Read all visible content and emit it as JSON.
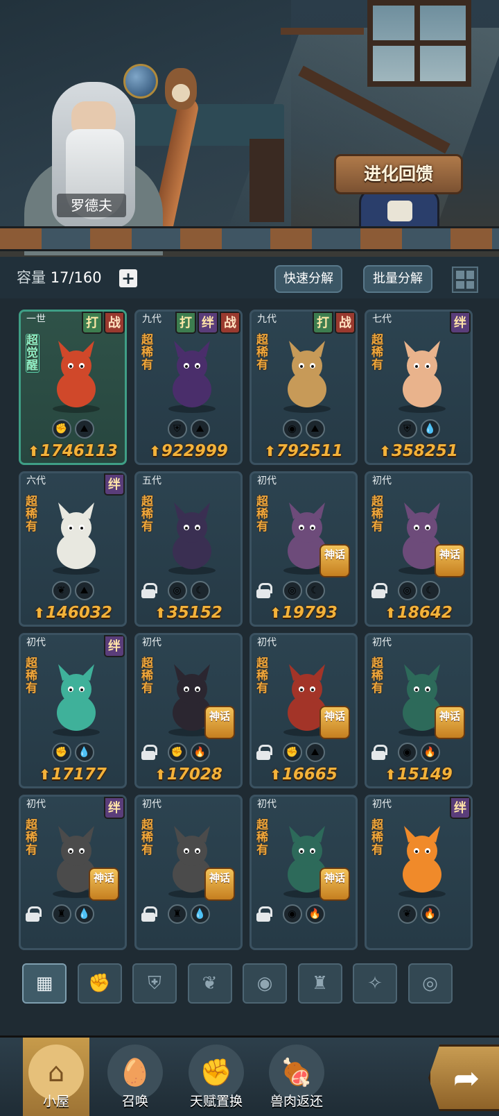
{
  "scene": {
    "npc_name": "罗德夫",
    "evolution_button": "进化回馈"
  },
  "capacity": {
    "label": "容量",
    "value": "17/160",
    "add_icon": "plus-icon"
  },
  "toolbar": {
    "quick_decompose": "快速分解",
    "batch_decompose": "批量分解",
    "view_toggle_icon": "grid-view-icon"
  },
  "cards": [
    {
      "gen": "一世",
      "rarity": "超觉醒",
      "tags": [
        "打",
        "战"
      ],
      "elements": [
        "fist-element",
        "earth-element"
      ],
      "power": "1746113",
      "locked": false,
      "mythic": false,
      "top_tier": true
    },
    {
      "gen": "九代",
      "rarity": "超稀有",
      "tags": [
        "打",
        "绊",
        "战"
      ],
      "elements": [
        "shield-element",
        "earth-element"
      ],
      "power": "922999",
      "locked": false,
      "mythic": false
    },
    {
      "gen": "九代",
      "rarity": "超稀有",
      "tags": [
        "打",
        "战"
      ],
      "elements": [
        "alien-element",
        "earth-element"
      ],
      "power": "792511",
      "locked": false,
      "mythic": false
    },
    {
      "gen": "七代",
      "rarity": "超稀有",
      "tags": [
        "绊"
      ],
      "elements": [
        "shield-element",
        "water-element"
      ],
      "power": "358251",
      "locked": false,
      "mythic": false
    },
    {
      "gen": "六代",
      "rarity": "超稀有",
      "tags": [
        "绊"
      ],
      "elements": [
        "sprout-element",
        "earth-element"
      ],
      "power": "146032",
      "locked": false,
      "mythic": false
    },
    {
      "gen": "五代",
      "rarity": "超稀有",
      "tags": [],
      "elements": [
        "eye-element",
        "moon-element"
      ],
      "power": "35152",
      "locked": true,
      "mythic": false
    },
    {
      "gen": "初代",
      "rarity": "超稀有",
      "tags": [],
      "elements": [
        "eye-element",
        "moon-element"
      ],
      "power": "19793",
      "locked": true,
      "mythic": true
    },
    {
      "gen": "初代",
      "rarity": "超稀有",
      "tags": [],
      "elements": [
        "eye-element",
        "moon-element"
      ],
      "power": "18642",
      "locked": true,
      "mythic": true
    },
    {
      "gen": "初代",
      "rarity": "超稀有",
      "tags": [
        "绊"
      ],
      "elements": [
        "fist-element",
        "water-element"
      ],
      "power": "17177",
      "locked": false,
      "mythic": false
    },
    {
      "gen": "初代",
      "rarity": "超稀有",
      "tags": [],
      "elements": [
        "fist-element",
        "fire-element"
      ],
      "power": "17028",
      "locked": true,
      "mythic": true
    },
    {
      "gen": "初代",
      "rarity": "超稀有",
      "tags": [],
      "elements": [
        "fist-element",
        "earth-element"
      ],
      "power": "16665",
      "locked": true,
      "mythic": true
    },
    {
      "gen": "初代",
      "rarity": "超稀有",
      "tags": [],
      "elements": [
        "alien-element",
        "fire-element"
      ],
      "power": "15149",
      "locked": true,
      "mythic": true
    },
    {
      "gen": "初代",
      "rarity": "超稀有",
      "tags": [
        "绊"
      ],
      "elements": [
        "tower-element",
        "water-element"
      ],
      "power": "",
      "locked": true,
      "mythic": true
    },
    {
      "gen": "初代",
      "rarity": "超稀有",
      "tags": [],
      "elements": [
        "tower-element",
        "water-element"
      ],
      "power": "",
      "locked": true,
      "mythic": true
    },
    {
      "gen": "初代",
      "rarity": "超稀有",
      "tags": [],
      "elements": [
        "alien-element",
        "fire-element"
      ],
      "power": "",
      "locked": true,
      "mythic": true
    },
    {
      "gen": "初代",
      "rarity": "超稀有",
      "tags": [
        "绊"
      ],
      "elements": [
        "sprout-element",
        "fire-element"
      ],
      "power": "",
      "locked": false,
      "mythic": false
    }
  ],
  "mythic_label": "神话",
  "filters": [
    "all-category-icon",
    "fist-category-icon",
    "shield-category-icon",
    "sprout-category-icon",
    "alien-category-icon",
    "tower-category-icon",
    "crosshair-category-icon",
    "eye-category-icon"
  ],
  "nav": [
    {
      "label": "小屋",
      "icon": "hut-icon",
      "active": true
    },
    {
      "label": "召唤",
      "icon": "egg-icon",
      "active": false
    },
    {
      "label": "天赋置换",
      "icon": "fist-icon",
      "active": false
    },
    {
      "label": "兽肉返还",
      "icon": "meat-icon",
      "active": false
    }
  ],
  "share_icon": "share-arrow-icon",
  "colors": {
    "power": "#f3b23a",
    "rarity": "#f0a73b",
    "panel": "#263a46",
    "accent_green": "#3f9f86"
  }
}
